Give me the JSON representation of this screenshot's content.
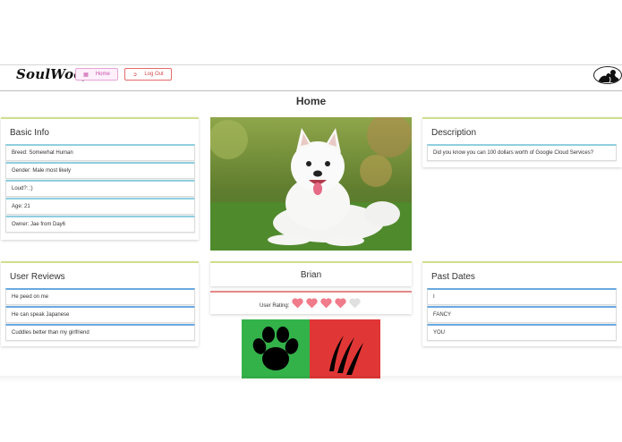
{
  "nav": {
    "logo": "SoulWoof",
    "home_label": "Home",
    "logout_label": "Log Out"
  },
  "page": {
    "title": "Home"
  },
  "basic_info": {
    "title": "Basic Info",
    "items": [
      "Breed: Somewhat Human",
      "Gender: Male most likely",
      "Loud?: ;)",
      "Age: 21",
      "Owner: Jae from Day6"
    ]
  },
  "description": {
    "title": "Description",
    "text": "Did you know you can 100 dollars worth of Google Cloud Services?"
  },
  "user_reviews": {
    "title": "User Reviews",
    "items": [
      "He peed on me",
      "He can speak Japanese",
      "Cuddles better than my girlfriend"
    ]
  },
  "profile": {
    "name": "Brian",
    "rating_label": "User Rating:",
    "rating": 4,
    "rating_max": 5
  },
  "past_dates": {
    "title": "Past Dates",
    "items": [
      "I",
      "FANCY",
      "YOU"
    ]
  },
  "colors": {
    "like": "#33b24a",
    "dislike": "#e13636",
    "heart_filled": "#f07b8a",
    "heart_empty": "#e0e0e0",
    "card_accent": "#cfe08c"
  },
  "icons": {
    "like": "paw-icon",
    "dislike": "claw-scratch-icon"
  }
}
